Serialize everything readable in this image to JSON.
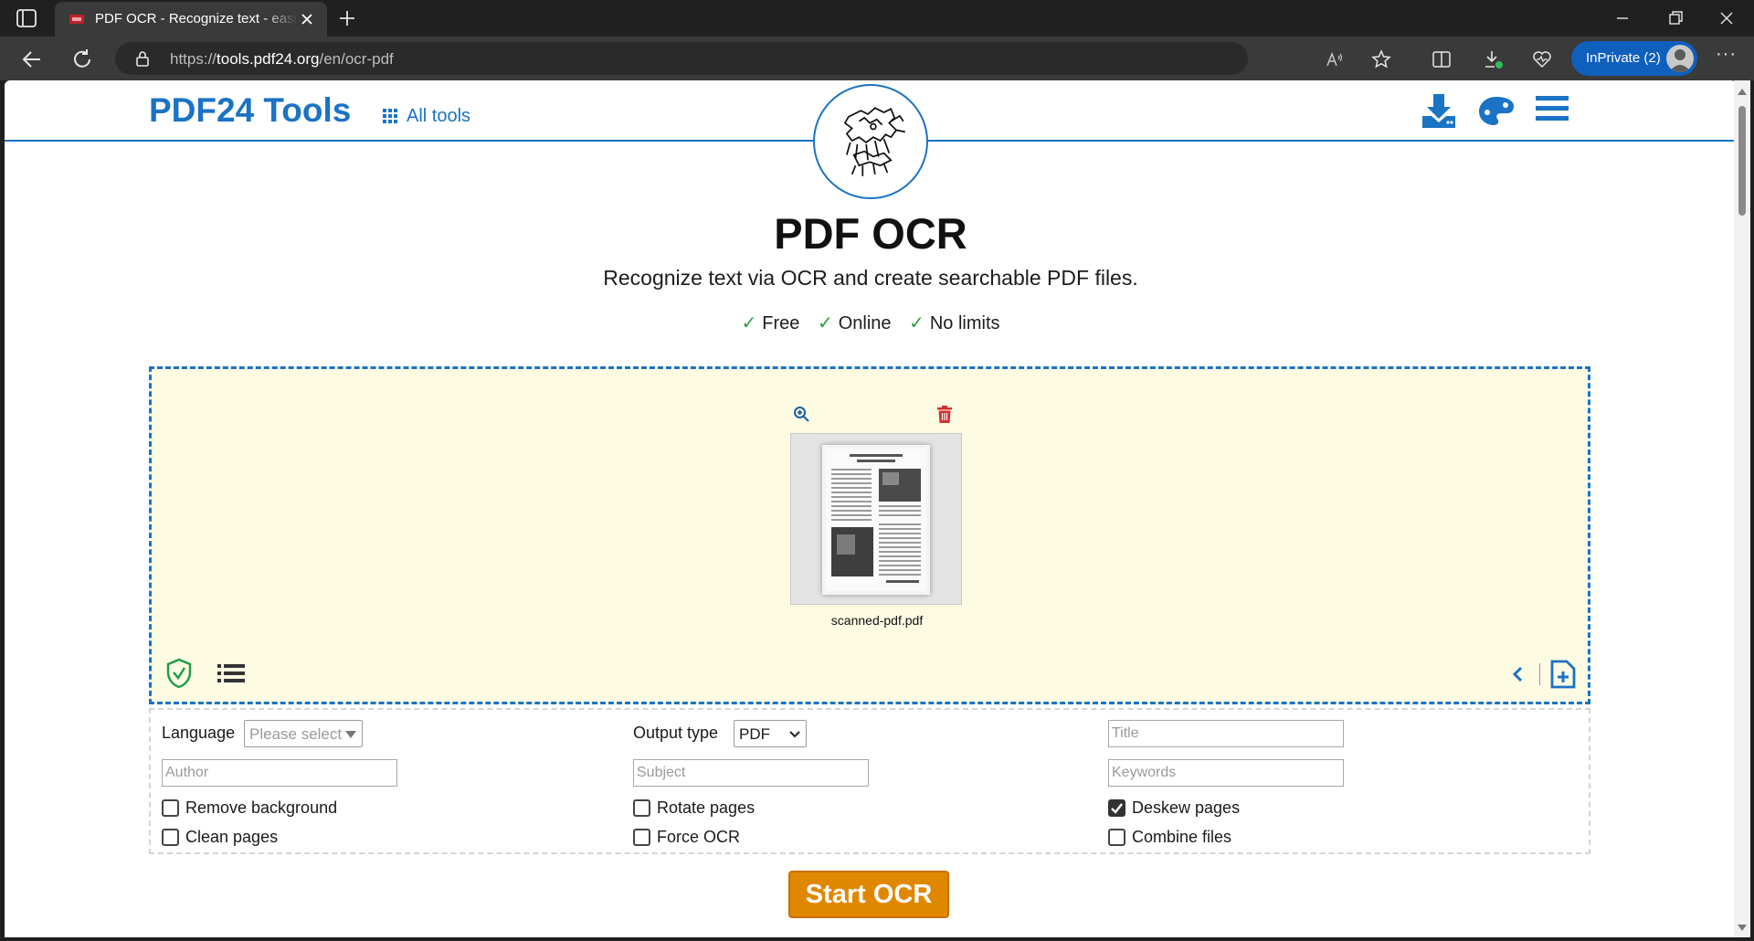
{
  "browser": {
    "tab_title": "PDF OCR - Recognize text - easily online",
    "url_prefix": "https://",
    "url_host": "tools.pdf24.org",
    "url_path": "/en/ocr-pdf",
    "inprivate_label": "InPrivate (2)",
    "more_label": "···"
  },
  "header": {
    "logo": "PDF24 Tools",
    "all_tools": "All tools",
    "icons": [
      "download-icon",
      "palette-icon",
      "hamburger-menu-icon"
    ],
    "accent_color": "#1a73c4"
  },
  "hero": {
    "title": "PDF OCR",
    "subtitle": "Recognize text via OCR and create searchable PDF files.",
    "check_mark": "✓",
    "features": [
      "Free",
      "Online",
      "No limits"
    ]
  },
  "dropzone": {
    "file_name": "scanned-pdf.pdf",
    "background": "#fefbe3",
    "icons": [
      "zoom-in-icon",
      "trash-icon",
      "shield-check-icon",
      "list-icon",
      "chevron-left-icon",
      "add-file-icon"
    ]
  },
  "options": {
    "language_label": "Language",
    "language_value": "Please select",
    "output_type_label": "Output type",
    "output_type_value": "PDF",
    "title_placeholder": "Title",
    "author_placeholder": "Author",
    "subject_placeholder": "Subject",
    "keywords_placeholder": "Keywords",
    "checkboxes": [
      {
        "label": "Remove background",
        "checked": false
      },
      {
        "label": "Rotate pages",
        "checked": false
      },
      {
        "label": "Deskew pages",
        "checked": true
      },
      {
        "label": "Clean pages",
        "checked": false
      },
      {
        "label": "Force OCR",
        "checked": false
      },
      {
        "label": "Combine files",
        "checked": false
      }
    ]
  },
  "actions": {
    "start_label": "Start OCR",
    "start_color": "#e08700"
  }
}
